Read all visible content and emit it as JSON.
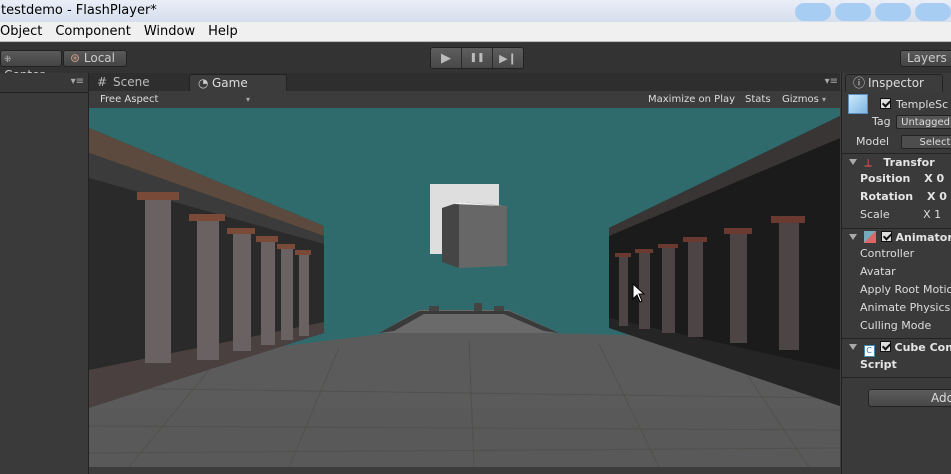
{
  "window": {
    "title": "testdemo - FlashPlayer*"
  },
  "menu": {
    "items": [
      "Object",
      "Component",
      "Window",
      "Help"
    ]
  },
  "toolbar": {
    "pivot_label": "Center",
    "space_label": "Local",
    "play_icons": [
      "▶",
      "❚❚",
      "▶❙"
    ],
    "layers_label": "Layers"
  },
  "tabs": {
    "scene": "Scene",
    "game": "Game"
  },
  "game_bar": {
    "aspect": "Free Aspect",
    "maximize": "Maximize on Play",
    "stats": "Stats",
    "gizmos": "Gizmos"
  },
  "inspector": {
    "tab": "Inspector",
    "object_name": "TempleSc",
    "tag_label": "Tag",
    "tag_value": "Untagged",
    "model_label": "Model",
    "model_select": "Select",
    "transform": {
      "title": "Transfor",
      "position_label": "Position",
      "position_x": "X 0",
      "rotation_label": "Rotation",
      "rotation_x": "X 0",
      "scale_label": "Scale",
      "scale_x": "X 1"
    },
    "animator": {
      "title": "Animator",
      "fields": [
        "Controller",
        "Avatar",
        "Apply Root Motio",
        "Animate Physics",
        "Culling Mode"
      ]
    },
    "script_component": {
      "title": "Cube Con",
      "script_label": "Script"
    },
    "add_button": "Add"
  },
  "colors": {
    "sky": "#2f6b6c",
    "floor": "#5c5c5c",
    "panel": "#3a3a3a",
    "titlebar": "#e4ebf5"
  }
}
